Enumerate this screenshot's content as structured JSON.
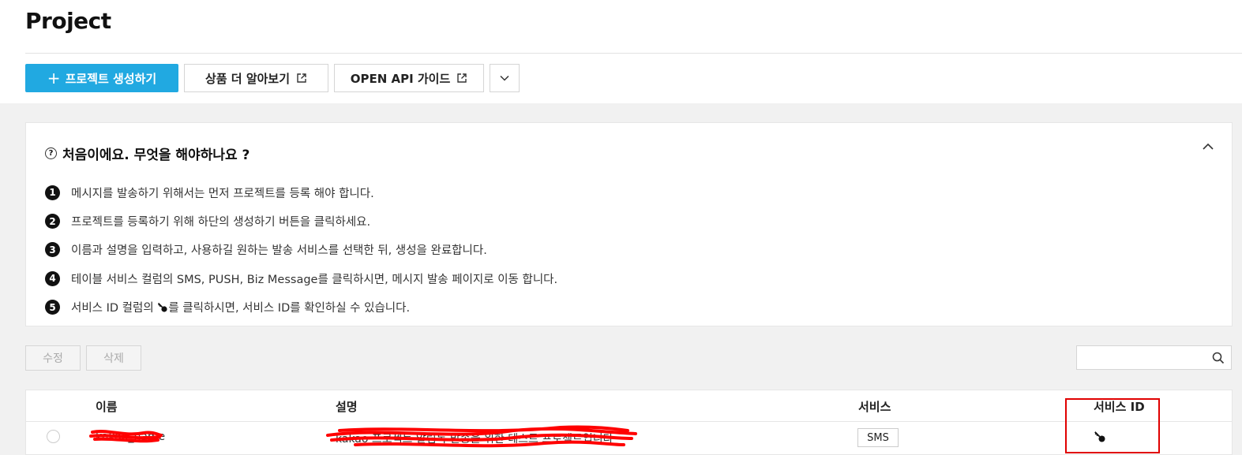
{
  "page": {
    "title": "Project"
  },
  "toolbar": {
    "create_label": "프로젝트 생성하기",
    "learn_label": "상품 더 알아보기",
    "api_label": "OPEN API 가이드"
  },
  "guide": {
    "title": "처음이에요. 무엇을 해야하나요 ?",
    "steps": [
      {
        "num": "1",
        "text": "메시지를 발송하기 위해서는 먼저 프로젝트를 등록 해야 합니다."
      },
      {
        "num": "2",
        "text": "프로젝트를 등록하기 위해 하단의 생성하기 버튼을 클릭하세요."
      },
      {
        "num": "3",
        "text": "이름과 설명을 입력하고, 사용하길 원하는 발송 서비스를 선택한 뒤, 생성을 완료합니다."
      },
      {
        "num": "4",
        "text": "테이블 서비스 컬럼의 SMS, PUSH, Biz Message를 클릭하시면, 메시지 발송 페이지로 이동 합니다."
      },
      {
        "num": "5",
        "text_before": "서비스 ID 컬럼의 ",
        "text_after": "를 클릭하시면, 서비스 ID를 확인하실 수 있습니다."
      }
    ]
  },
  "actions": {
    "edit_label": "수정",
    "delete_label": "삭제"
  },
  "search": {
    "value": "",
    "placeholder": ""
  },
  "table": {
    "headers": {
      "name": "이름",
      "description": "설명",
      "service": "서비스",
      "service_id": "서비스 ID"
    },
    "rows": [
      {
        "name": "kakao_name",
        "description": "kakao 프로젝트 알림톡 발송을 위한 테스트 프로젝트입니다",
        "service": "SMS"
      }
    ]
  },
  "colors": {
    "primary": "#21a9e1",
    "highlight": "#e00000",
    "redaction": "#ff0000"
  },
  "icons": [
    "plus-icon",
    "external-link-icon",
    "chevron-down-icon",
    "question-circle-icon",
    "chevron-up-icon",
    "key-icon",
    "search-icon"
  ]
}
